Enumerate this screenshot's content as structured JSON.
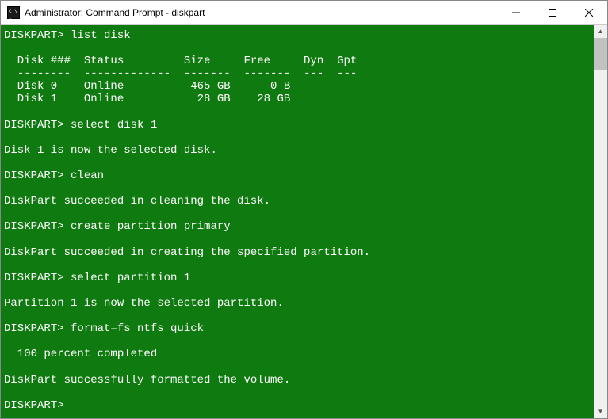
{
  "window": {
    "title": "Administrator: Command Prompt - diskpart"
  },
  "terminal": {
    "prompt": "DISKPART>",
    "lines": [
      {
        "type": "cmd",
        "text": "DISKPART> list disk"
      },
      {
        "type": "blank",
        "text": ""
      },
      {
        "type": "out",
        "text": "  Disk ###  Status         Size     Free     Dyn  Gpt"
      },
      {
        "type": "out",
        "text": "  --------  -------------  -------  -------  ---  ---"
      },
      {
        "type": "out",
        "text": "  Disk 0    Online          465 GB      0 B"
      },
      {
        "type": "out",
        "text": "  Disk 1    Online           28 GB    28 GB"
      },
      {
        "type": "blank",
        "text": ""
      },
      {
        "type": "cmd",
        "text": "DISKPART> select disk 1"
      },
      {
        "type": "blank",
        "text": ""
      },
      {
        "type": "out",
        "text": "Disk 1 is now the selected disk."
      },
      {
        "type": "blank",
        "text": ""
      },
      {
        "type": "cmd",
        "text": "DISKPART> clean"
      },
      {
        "type": "blank",
        "text": ""
      },
      {
        "type": "out",
        "text": "DiskPart succeeded in cleaning the disk."
      },
      {
        "type": "blank",
        "text": ""
      },
      {
        "type": "cmd",
        "text": "DISKPART> create partition primary"
      },
      {
        "type": "blank",
        "text": ""
      },
      {
        "type": "out",
        "text": "DiskPart succeeded in creating the specified partition."
      },
      {
        "type": "blank",
        "text": ""
      },
      {
        "type": "cmd",
        "text": "DISKPART> select partition 1"
      },
      {
        "type": "blank",
        "text": ""
      },
      {
        "type": "out",
        "text": "Partition 1 is now the selected partition."
      },
      {
        "type": "blank",
        "text": ""
      },
      {
        "type": "cmd",
        "text": "DISKPART> format=fs ntfs quick"
      },
      {
        "type": "blank",
        "text": ""
      },
      {
        "type": "out",
        "text": "  100 percent completed"
      },
      {
        "type": "blank",
        "text": ""
      },
      {
        "type": "out",
        "text": "DiskPart successfully formatted the volume."
      },
      {
        "type": "blank",
        "text": ""
      },
      {
        "type": "cmd",
        "text": "DISKPART>"
      }
    ]
  },
  "disk_table": {
    "columns": [
      "Disk ###",
      "Status",
      "Size",
      "Free",
      "Dyn",
      "Gpt"
    ],
    "rows": [
      {
        "disk": "Disk 0",
        "status": "Online",
        "size": "465 GB",
        "free": "0 B",
        "dyn": "",
        "gpt": ""
      },
      {
        "disk": "Disk 1",
        "status": "Online",
        "size": "28 GB",
        "free": "28 GB",
        "dyn": "",
        "gpt": ""
      }
    ]
  }
}
